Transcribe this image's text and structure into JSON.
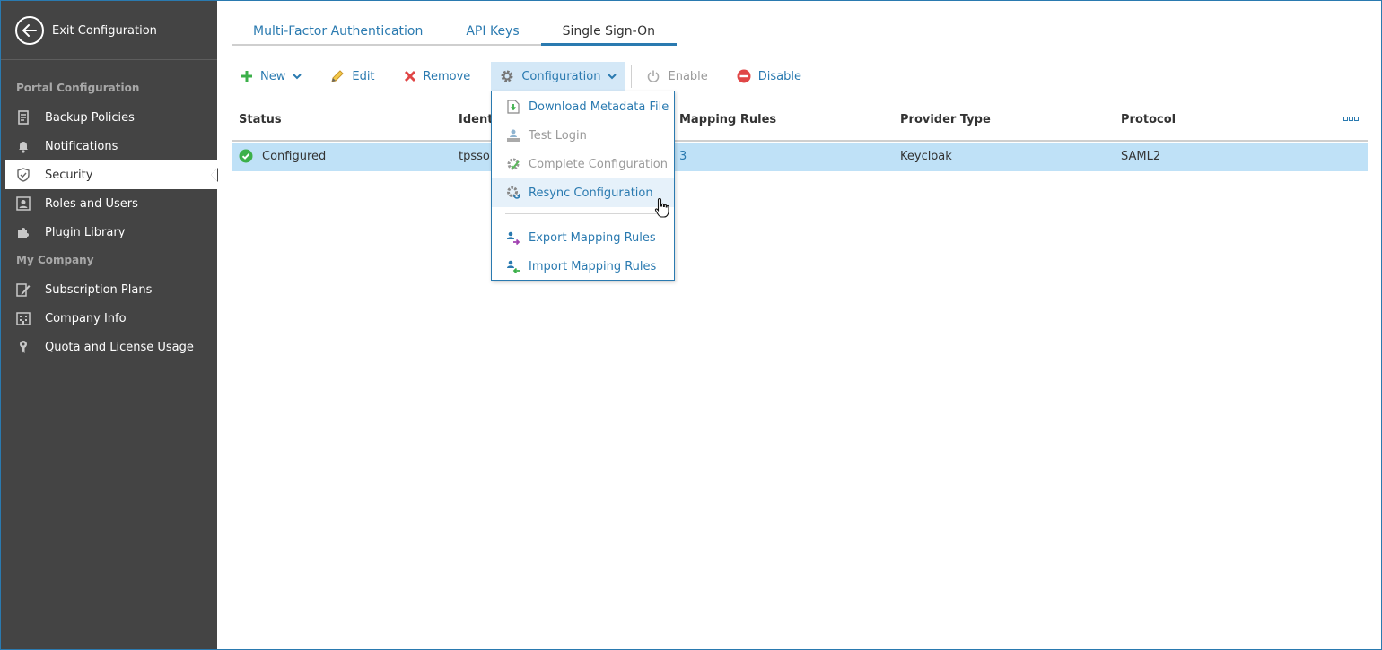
{
  "sidebar": {
    "exit_label": "Exit Configuration",
    "sections": [
      {
        "title": "Portal Configuration"
      },
      {
        "title": "My Company"
      }
    ],
    "items": [
      {
        "label": "Backup Policies",
        "icon": "backup-policies-icon"
      },
      {
        "label": "Notifications",
        "icon": "bell-icon"
      },
      {
        "label": "Security",
        "icon": "shield-icon",
        "active": true
      },
      {
        "label": "Roles and Users",
        "icon": "user-card-icon"
      },
      {
        "label": "Plugin Library",
        "icon": "puzzle-icon"
      },
      {
        "label": "Subscription Plans",
        "icon": "pencil-doc-icon"
      },
      {
        "label": "Company Info",
        "icon": "building-icon"
      },
      {
        "label": "Quota and License Usage",
        "icon": "key-icon"
      }
    ]
  },
  "tabs": [
    {
      "label": "Multi-Factor Authentication"
    },
    {
      "label": "API Keys"
    },
    {
      "label": "Single Sign-On",
      "active": true
    }
  ],
  "toolbar": {
    "new_label": "New",
    "edit_label": "Edit",
    "remove_label": "Remove",
    "configuration_label": "Configuration",
    "enable_label": "Enable",
    "disable_label": "Disable"
  },
  "grid": {
    "columns": [
      "Status",
      "Ident",
      "Mapping Rules",
      "Provider Type",
      "Protocol"
    ],
    "rows": [
      {
        "status": "Configured",
        "identity": "tpsso",
        "mapping_rules": "3",
        "provider_type": "Keycloak",
        "protocol": "SAML2"
      }
    ]
  },
  "configuration_menu": {
    "items": [
      {
        "label": "Download Metadata File",
        "icon": "download-file-icon",
        "enabled": true
      },
      {
        "label": "Test Login",
        "icon": "test-login-icon",
        "enabled": false
      },
      {
        "label": "Complete Configuration",
        "icon": "gear-check-icon",
        "enabled": false
      },
      {
        "label": "Resync Configuration",
        "icon": "gear-sync-icon",
        "enabled": true,
        "hover": true
      },
      {
        "label": "Export Mapping Rules",
        "icon": "export-users-icon",
        "enabled": true
      },
      {
        "label": "Import Mapping Rules",
        "icon": "import-users-icon",
        "enabled": true
      }
    ]
  },
  "colors": {
    "sidebar_bg": "#444444",
    "accent": "#2a7ab0",
    "selected_row": "#bfe1f7",
    "success": "#3cb04a",
    "danger": "#e04646"
  }
}
